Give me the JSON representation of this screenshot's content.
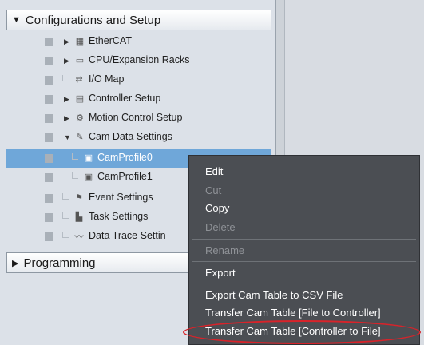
{
  "multiview": {
    "configurations_header": "Configurations and Setup",
    "programming_header": "Programming",
    "tree": [
      {
        "label": "EtherCAT",
        "icon": "ethercat-icon"
      },
      {
        "label": "CPU/Expansion Racks",
        "icon": "rack-icon"
      },
      {
        "label": "I/O Map",
        "icon": "io-map-icon"
      },
      {
        "label": "Controller Setup",
        "icon": "controller-setup-icon"
      },
      {
        "label": "Motion Control Setup",
        "icon": "gear-icon"
      },
      {
        "label": "Cam Data Settings",
        "icon": "cam-icon"
      },
      {
        "label": "CamProfile0",
        "icon": "cam-profile-icon"
      },
      {
        "label": "CamProfile1",
        "icon": "cam-profile-icon"
      },
      {
        "label": "Event Settings",
        "icon": "flag-icon"
      },
      {
        "label": "Task Settings",
        "icon": "task-icon"
      },
      {
        "label": "Data Trace Settin",
        "icon": "trace-icon"
      }
    ]
  },
  "context_menu": {
    "items": [
      {
        "label": "Edit",
        "enabled": true
      },
      {
        "label": "Cut",
        "enabled": false
      },
      {
        "label": "Copy",
        "enabled": true
      },
      {
        "label": "Delete",
        "enabled": false
      },
      {
        "label": "Rename",
        "enabled": false
      },
      {
        "label": "Export",
        "enabled": true
      },
      {
        "label": "Export Cam Table to CSV File",
        "enabled": true
      },
      {
        "label": "Transfer Cam Table [File to Controller]",
        "enabled": true
      },
      {
        "label": "Transfer Cam Table [Controller to File]",
        "enabled": true
      }
    ]
  },
  "colors": {
    "selection": "#6fa7d9",
    "menu_background": "#4b4e53",
    "highlight_ring": "#d8232a"
  }
}
